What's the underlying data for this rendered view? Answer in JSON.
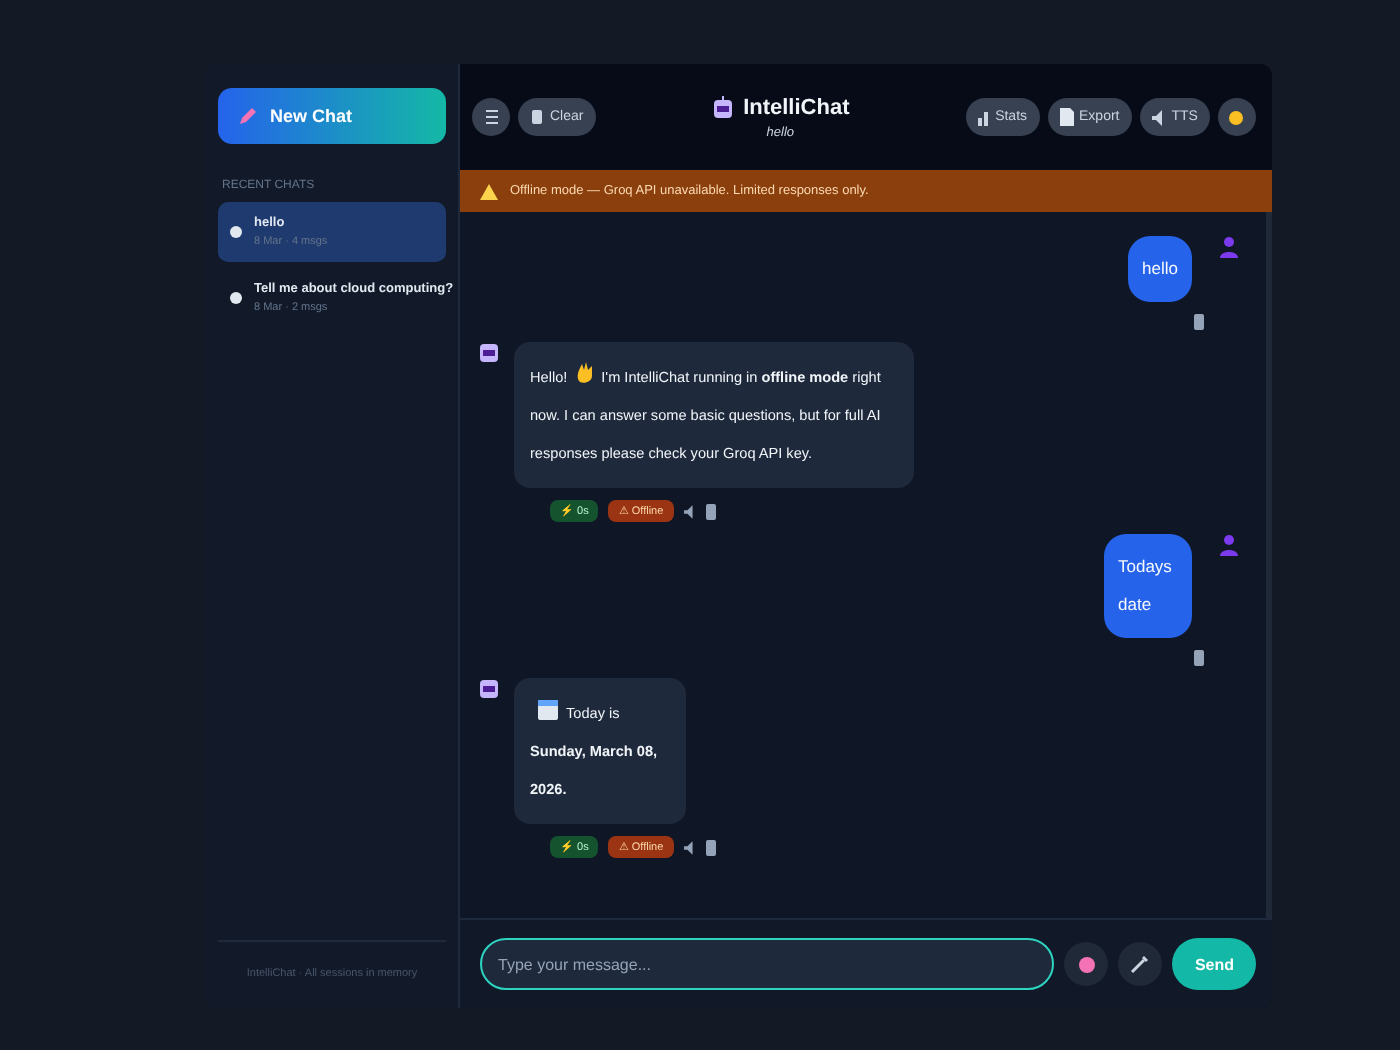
{
  "sidebar": {
    "new_chat": "New Chat",
    "section_label": "RECENT CHATS",
    "chats": [
      {
        "title": "hello",
        "meta": "8 Mar · 4 msgs",
        "selected": true
      },
      {
        "title": "Tell me about cloud computing?",
        "meta": "8 Mar · 2 msgs",
        "selected": false
      }
    ],
    "footer": "IntelliChat · All sessions in memory"
  },
  "header": {
    "clear": "Clear",
    "title": "IntelliChat",
    "subtitle": "hello",
    "stats": "Stats",
    "export": "Export",
    "tts": "TTS"
  },
  "banner": "Offline mode — Groq API unavailable. Limited responses only.",
  "messages": [
    {
      "kind": "user",
      "segments": [
        {
          "kind": "text",
          "text": "hello"
        }
      ]
    },
    {
      "kind": "bot",
      "segments": [
        {
          "kind": "text",
          "text": "Hello!"
        },
        {
          "kind": "wave"
        },
        {
          "kind": "text",
          "text": "I'm IntelliChat running in **offline mode** right now. I can answer some basic questions, but for full AI responses please check your Groq API key."
        }
      ],
      "badges": [
        "⚡ 0s",
        "⚠ Offline"
      ]
    },
    {
      "kind": "user",
      "segments": [
        {
          "kind": "text",
          "text": "Todays date"
        }
      ]
    },
    {
      "kind": "bot",
      "segments": [
        {
          "kind": "calendar"
        },
        {
          "kind": "text",
          "text": "Today is **Sunday, March 08, 2026.**"
        }
      ],
      "badges": [
        "⚡ 0s",
        "⚠ Offline"
      ]
    }
  ],
  "composer": {
    "placeholder": "Type your message...",
    "send": "Send"
  }
}
